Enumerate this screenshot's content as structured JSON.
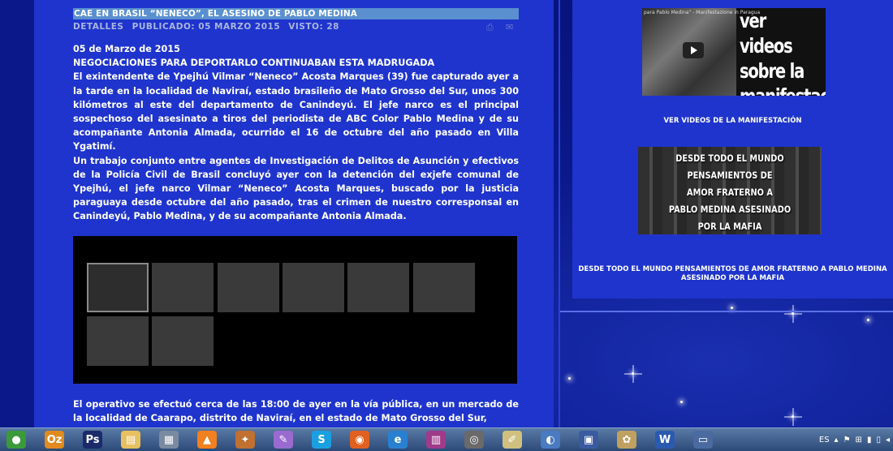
{
  "article": {
    "title": "CAE EN BRASIL “NENECO”, EL ASESINO DE PABLO MEDINA",
    "meta": {
      "details": "DETALLES",
      "published": "PUBLICADO: 05 MARZO 2015",
      "views": "VISTO: 28"
    },
    "date": "05 de Marzo de 2015",
    "subtitle": "NEGOCIACIONES PARA DEPORTARLO CONTINUABAN ESTA MADRUGADA",
    "paragraph1": "El exintendente de Ypejhú Vilmar “Neneco” Acosta Marques (39) fue capturado ayer a la tarde en la localidad de Naviraí, estado brasileño de Mato Grosso del Sur, unos 300 kilómetros al este del departamento de Canindeyú. El jefe narco es el principal sospechoso del asesinato a tiros del periodista de ABC Color Pablo Medina y de su acompañante Antonia Almada, ocurrido el 16 de octubre del año pasado en Villa Ygatimí.",
    "paragraph2": "Un trabajo conjunto entre agentes de Investigación de Delitos de Asunción y efectivos de la Policía Civil de Brasil concluyó ayer con la detención del exjefe comunal de Ypejhú, el jefe narco Vilmar “Neneco” Acosta Marques, buscado por la justicia paraguaya desde octubre del año pasado, tras el crimen de nuestro corresponsal en Canindeyú, Pablo Medina, y de su acompañante Antonia Almada.",
    "paragraph3": "El operativo se efectuó cerca de las 18:00 de ayer en la vía pública, en un mercado de la localidad de Caarapo, distrito de Naviraí, en el estado de Mato Grosso del Sur,"
  },
  "sidebar": {
    "banner1_caption": "para Pablo Medina\" - Manifestazione in Paragua",
    "banner1_text": "ver videos\nsobre la\nmanifestación",
    "link1": "VER VIDEOS DE LA MANIFESTACIÓN",
    "banner2_text": "DESDE TODO EL MUNDO\nPENSAMIENTOS DE\nAMOR FRATERNO A\nPABLO MEDINA ASESINADO\nPOR LA MAFIA",
    "link2": "DESDE TODO EL MUNDO PENSAMIENTOS DE AMOR FRATERNO A PABLO MEDINA ASESINADO POR LA MAFIA"
  },
  "taskbar": {
    "apps": [
      {
        "name": "chrome-icon",
        "glyph": "●",
        "color": "#3a9a3a"
      },
      {
        "name": "outlook-icon",
        "glyph": "Oz",
        "color": "#e08a20"
      },
      {
        "name": "photoshop-icon",
        "glyph": "Ps",
        "color": "#1a2a6a"
      },
      {
        "name": "folder-icon",
        "glyph": "▤",
        "color": "#e8c060"
      },
      {
        "name": "calculator-icon",
        "glyph": "▦",
        "color": "#7a8aa0"
      },
      {
        "name": "vlc-icon",
        "glyph": "▲",
        "color": "#f08020"
      },
      {
        "name": "media-icon",
        "glyph": "✦",
        "color": "#c07030"
      },
      {
        "name": "paint-icon",
        "glyph": "✎",
        "color": "#9a6ad0"
      },
      {
        "name": "skype-icon",
        "glyph": "S",
        "color": "#1aa0e0"
      },
      {
        "name": "firefox-icon",
        "glyph": "◉",
        "color": "#e06020"
      },
      {
        "name": "ie-icon",
        "glyph": "e",
        "color": "#2a80d0"
      },
      {
        "name": "winrar-icon",
        "glyph": "▥",
        "color": "#a03a8a"
      },
      {
        "name": "webcam-icon",
        "glyph": "◎",
        "color": "#6a6a6a"
      },
      {
        "name": "notepad-icon",
        "glyph": "✐",
        "color": "#d0c080"
      },
      {
        "name": "network-icon",
        "glyph": "◐",
        "color": "#4a7ac0"
      },
      {
        "name": "save-icon",
        "glyph": "▣",
        "color": "#3a5aa0"
      },
      {
        "name": "palette-icon",
        "glyph": "✿",
        "color": "#c0a060"
      },
      {
        "name": "word-icon",
        "glyph": "W",
        "color": "#2a5ab0"
      },
      {
        "name": "screen-icon",
        "glyph": "▭",
        "color": "#4a6aa0"
      }
    ],
    "language": "ES"
  }
}
